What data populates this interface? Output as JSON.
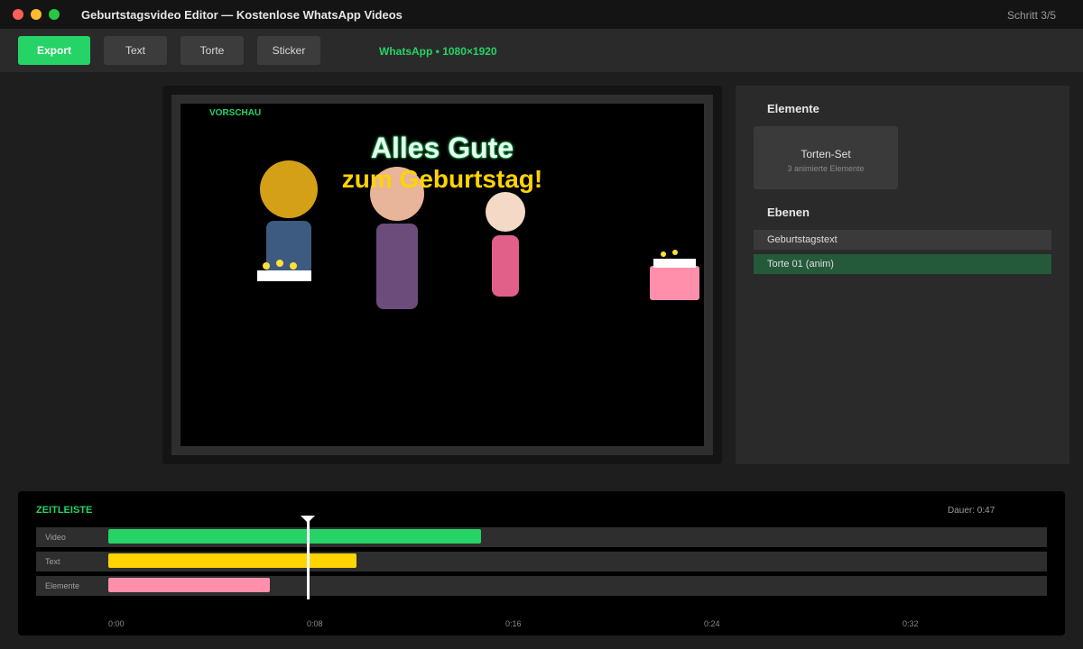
{
  "window": {
    "title": "Geburtstagsvideo Editor — Kostenlose WhatsApp Videos",
    "step": "Schritt 3/5"
  },
  "toolbar": {
    "export_label": "Export",
    "text_label": "Text",
    "torte_label": "Torte",
    "sticker_label": "Sticker",
    "format": "WhatsApp • 1080×1920"
  },
  "preview": {
    "label": "VORSCHAU",
    "title_line1": "Alles Gute",
    "title_line2": "zum Geburtstag!"
  },
  "sidebar": {
    "elements_heading": "Elemente",
    "card_title": "Torten-Set",
    "card_subtitle": "3 animierte Elemente",
    "layers_heading": "Ebenen",
    "layers": [
      {
        "label": "Geburtstagstext",
        "active": false
      },
      {
        "label": "Torte 01 (anim)",
        "active": true
      }
    ]
  },
  "timeline": {
    "label": "ZEITLEISTE",
    "duration": "Dauer: 0:47",
    "total_seconds": 40,
    "playhead_seconds": 8,
    "tracks": [
      {
        "label": "Video",
        "start": 0,
        "end": 15,
        "color": "#25d366"
      },
      {
        "label": "Text",
        "start": 0,
        "end": 10,
        "color": "#ffd400"
      },
      {
        "label": "Elemente",
        "start": 0,
        "end": 6.5,
        "color": "#ff8fab"
      }
    ],
    "ticks": [
      "0:00",
      "0:08",
      "0:16",
      "0:24",
      "0:32"
    ]
  },
  "colors": {
    "accent": "#25d366",
    "title_yellow": "#ffd400",
    "cake_pink": "#ff8fab"
  }
}
